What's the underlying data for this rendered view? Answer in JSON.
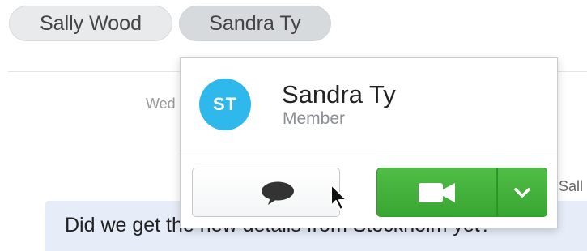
{
  "tabs": [
    {
      "label": "Sally Wood",
      "active": false
    },
    {
      "label": "Sandra Ty",
      "active": true
    }
  ],
  "conversation": {
    "date_fragment": "Wed",
    "sender_fragment": "Sall",
    "message_text": "Did we get the new details from Stockholm yet?"
  },
  "profile_popover": {
    "avatar_initials": "ST",
    "avatar_color": "#2fb8ec",
    "name": "Sandra Ty",
    "role": "Member",
    "actions": {
      "message_icon": "speech-bubble-icon",
      "video_icon": "video-camera-icon",
      "dropdown_icon": "chevron-down-icon",
      "call_color": "#3fb13a"
    }
  }
}
